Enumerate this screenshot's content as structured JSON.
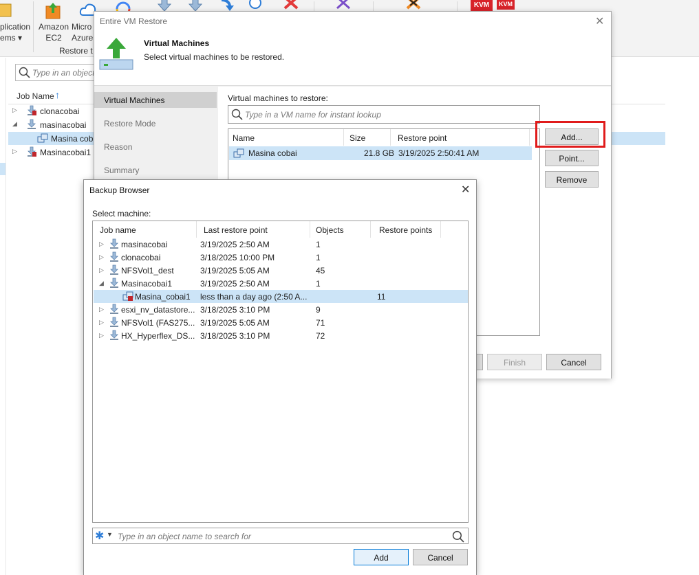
{
  "ribbon": {
    "items": [
      {
        "label_line1": "plication",
        "label_line2": "ems ▾"
      },
      {
        "label_line1": "Amazon",
        "label_line2": "EC2"
      },
      {
        "label_line1": "Micro",
        "label_line2": "Azure"
      }
    ],
    "group_label": "Restore t",
    "badges": [
      "KVM",
      "KVM"
    ]
  },
  "main": {
    "search_placeholder": "Type in an object",
    "column_job_name": "Job Name",
    "sort_indicator": "↑",
    "tree": [
      {
        "label": "clonacobai",
        "expander": "▷"
      },
      {
        "label": "masinacobai",
        "expander": "◢"
      },
      {
        "label": "Masina cob",
        "expander": ""
      },
      {
        "label": "Masinacobai1",
        "expander": "▷"
      }
    ]
  },
  "vm_restore": {
    "title": "Entire VM Restore",
    "close": "✕",
    "header_title": "Virtual Machines",
    "header_subtitle": "Select virtual machines to be restored.",
    "nav": [
      "Virtual Machines",
      "Restore Mode",
      "Reason",
      "Summary"
    ],
    "list_label": "Virtual machines to restore:",
    "lookup_placeholder": "Type in a VM name for instant lookup",
    "columns": [
      "Name",
      "Size",
      "Restore point"
    ],
    "rows": [
      {
        "name": "Masina cobai",
        "size": "21.8 GB",
        "restore_point": "3/19/2025 2:50:41 AM"
      }
    ],
    "buttons": {
      "add": "Add...",
      "point": "Point...",
      "remove": "Remove",
      "finish": "Finish",
      "cancel": "Cancel"
    }
  },
  "backup_browser": {
    "title": "Backup Browser",
    "close": "✕",
    "select_label": "Select machine:",
    "columns": [
      "Job name",
      "Last restore point",
      "Objects",
      "Restore points"
    ],
    "rows": [
      {
        "expander": "▷",
        "name": "masinacobai",
        "last": "3/19/2025 2:50 AM",
        "objects": "1",
        "points": ""
      },
      {
        "expander": "▷",
        "name": "clonacobai",
        "last": "3/18/2025 10:00 PM",
        "objects": "1",
        "points": ""
      },
      {
        "expander": "▷",
        "name": "NFSVol1_dest",
        "last": "3/19/2025 5:05 AM",
        "objects": "45",
        "points": ""
      },
      {
        "expander": "◢",
        "name": "Masinacobai1",
        "last": "3/19/2025 2:50 AM",
        "objects": "1",
        "points": ""
      },
      {
        "expander": "",
        "name": "Masina_cobai1",
        "last": "less than a day ago (2:50 A...",
        "objects": "",
        "points": "11"
      },
      {
        "expander": "▷",
        "name": "esxi_nv_datastore...",
        "last": "3/18/2025 3:10 PM",
        "objects": "9",
        "points": ""
      },
      {
        "expander": "▷",
        "name": "NFSVol1 (FAS275...",
        "last": "3/19/2025 5:05 AM",
        "objects": "71",
        "points": ""
      },
      {
        "expander": "▷",
        "name": "HX_Hyperflex_DS...",
        "last": "3/18/2025 3:10 PM",
        "objects": "72",
        "points": ""
      }
    ],
    "search_placeholder": "Type in an object name to search for",
    "buttons": {
      "add": "Add",
      "cancel": "Cancel"
    }
  },
  "colors": {
    "selection": "#cce4f7",
    "highlight_box": "#e01b1b",
    "accent": "#0078d7",
    "backup_green": "#3aa83a"
  }
}
